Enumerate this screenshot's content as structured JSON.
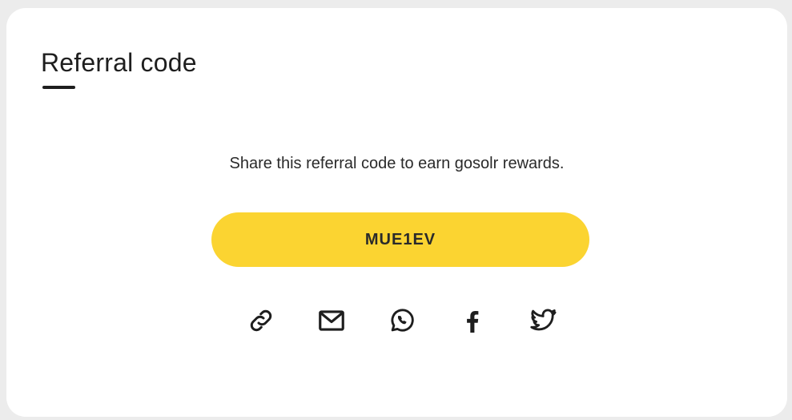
{
  "card": {
    "title": "Referral code",
    "description": "Share this referral code to earn gosolr rewards.",
    "code": "MUE1EV"
  },
  "share_options": [
    {
      "icon": "link-icon"
    },
    {
      "icon": "mail-icon"
    },
    {
      "icon": "whatsapp-icon"
    },
    {
      "icon": "facebook-icon"
    },
    {
      "icon": "twitter-icon"
    }
  ],
  "colors": {
    "accent": "#fbd431",
    "text": "#1e1e1e",
    "background": "#ffffff"
  }
}
